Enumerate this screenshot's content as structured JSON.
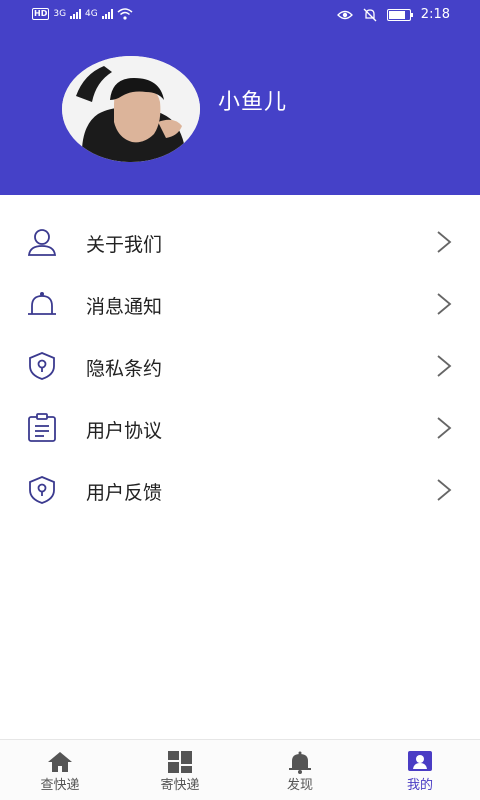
{
  "status_bar": {
    "left_badge": "HD",
    "net1": "3G",
    "net2": "4G",
    "time": "2:18"
  },
  "profile": {
    "username": "小鱼儿"
  },
  "menu": {
    "items": [
      {
        "label": "关于我们",
        "icon": "person-icon"
      },
      {
        "label": "消息通知",
        "icon": "bell-icon"
      },
      {
        "label": "隐私条约",
        "icon": "shield-icon"
      },
      {
        "label": "用户协议",
        "icon": "clipboard-icon"
      },
      {
        "label": "用户反馈",
        "icon": "shield-icon"
      }
    ]
  },
  "tabs": [
    {
      "label": "查快递",
      "icon": "home-icon"
    },
    {
      "label": "寄快递",
      "icon": "grid-icon"
    },
    {
      "label": "发现",
      "icon": "bell-icon"
    },
    {
      "label": "我的",
      "icon": "profile-card-icon",
      "active": true
    }
  ],
  "colors": {
    "header": "#4541c8",
    "accent": "#4a3cc4",
    "icon_stroke": "#3b3a8f"
  }
}
